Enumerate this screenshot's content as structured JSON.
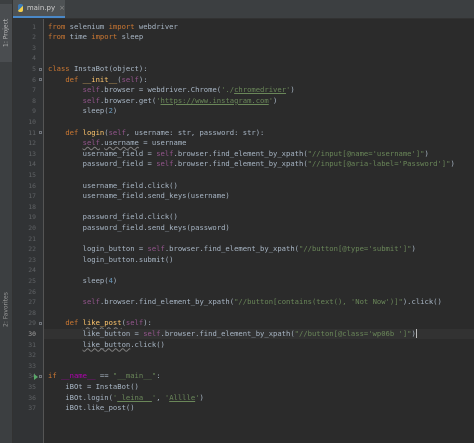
{
  "sidebar": {
    "project_tab_label": "1: Project",
    "favorites_label": "2: Favorites"
  },
  "tab": {
    "label": "main.py",
    "close_glyph": "×"
  },
  "editor": {
    "current_line": 30,
    "line_numbers": [
      "1",
      "2",
      "3",
      "4",
      "5",
      "6",
      "7",
      "8",
      "9",
      "10",
      "11",
      "12",
      "13",
      "14",
      "15",
      "16",
      "17",
      "18",
      "19",
      "20",
      "21",
      "22",
      "23",
      "24",
      "25",
      "26",
      "27",
      "28",
      "29",
      "30",
      "31",
      "32",
      "33",
      "34",
      "35",
      "36",
      "37"
    ],
    "lines": [
      [
        [
          "kw",
          "from"
        ],
        [
          "t",
          " selenium "
        ],
        [
          "kw",
          "import"
        ],
        [
          "t",
          " webdriver"
        ]
      ],
      [
        [
          "kw",
          "from"
        ],
        [
          "t",
          " time "
        ],
        [
          "kw",
          "import"
        ],
        [
          "t",
          " sleep"
        ]
      ],
      [],
      [],
      [
        [
          "kw",
          "class"
        ],
        [
          "t",
          " InstaBot(object):"
        ]
      ],
      [
        [
          "t",
          "    "
        ],
        [
          "kw",
          "def"
        ],
        [
          "t",
          " "
        ],
        [
          "fn",
          "__init__"
        ],
        [
          "t",
          "("
        ],
        [
          "self",
          "self"
        ],
        [
          "t",
          "):"
        ]
      ],
      [
        [
          "t",
          "        "
        ],
        [
          "self",
          "self"
        ],
        [
          "t",
          ".browser = webdriver.Chrome("
        ],
        [
          "str",
          "'./"
        ],
        [
          "strul",
          "chromedriver"
        ],
        [
          "str",
          "'"
        ],
        [
          "t",
          ")"
        ]
      ],
      [
        [
          "t",
          "        "
        ],
        [
          "self",
          "self"
        ],
        [
          "t",
          ".browser.get("
        ],
        [
          "str",
          "'"
        ],
        [
          "strul",
          "https://www.instagram.com"
        ],
        [
          "str",
          "'"
        ],
        [
          "t",
          ")"
        ]
      ],
      [
        [
          "t",
          "        sleep("
        ],
        [
          "num",
          "2"
        ],
        [
          "t",
          ")"
        ]
      ],
      [],
      [
        [
          "t",
          "    "
        ],
        [
          "kw",
          "def"
        ],
        [
          "t",
          " "
        ],
        [
          "fn",
          "login"
        ],
        [
          "t",
          "("
        ],
        [
          "self",
          "self"
        ],
        [
          "t",
          ", username: str, password: str):"
        ]
      ],
      [
        [
          "t",
          "        "
        ],
        [
          "selfw",
          "self"
        ],
        [
          "t",
          "."
        ],
        [
          "tw",
          "username"
        ],
        [
          "t",
          " = username"
        ]
      ],
      [
        [
          "t",
          "        username_field = "
        ],
        [
          "self",
          "self"
        ],
        [
          "t",
          ".browser.find_element_by_xpath("
        ],
        [
          "str",
          "\"//input[@name='username']\""
        ],
        [
          "t",
          ")"
        ]
      ],
      [
        [
          "t",
          "        password_field = "
        ],
        [
          "self",
          "self"
        ],
        [
          "t",
          ".browser.find_element_by_xpath("
        ],
        [
          "str",
          "\"//input[@aria-label='Password']\""
        ],
        [
          "t",
          ")"
        ]
      ],
      [],
      [
        [
          "t",
          "        username_field.click()"
        ]
      ],
      [
        [
          "t",
          "        username_field.send_keys(username)"
        ]
      ],
      [],
      [
        [
          "t",
          "        password_field.click()"
        ]
      ],
      [
        [
          "t",
          "        password_field.send_keys(password)"
        ]
      ],
      [],
      [
        [
          "t",
          "        login_button = "
        ],
        [
          "self",
          "self"
        ],
        [
          "t",
          ".browser.find_element_by_xpath("
        ],
        [
          "str",
          "\"//button[@type='submit']\""
        ],
        [
          "t",
          ")"
        ]
      ],
      [
        [
          "t",
          "        login_button.submit()"
        ]
      ],
      [],
      [
        [
          "t",
          "        sleep("
        ],
        [
          "num",
          "4"
        ],
        [
          "t",
          ")"
        ]
      ],
      [],
      [
        [
          "t",
          "        "
        ],
        [
          "self",
          "self"
        ],
        [
          "t",
          ".browser.find_element_by_xpath("
        ],
        [
          "str",
          "\"//button[contains(text(), 'Not Now')]\""
        ],
        [
          "t",
          ").click()"
        ]
      ],
      [],
      [
        [
          "t",
          "    "
        ],
        [
          "kw",
          "def"
        ],
        [
          "t",
          " "
        ],
        [
          "fnw",
          "like_post"
        ],
        [
          "t",
          "("
        ],
        [
          "self",
          "self"
        ],
        [
          "t",
          "):"
        ]
      ],
      [
        [
          "t",
          "        like_button = "
        ],
        [
          "self",
          "self"
        ],
        [
          "t",
          ".browser.find_element_by_xpath("
        ],
        [
          "str",
          "\"//button[@class='wp06b ']\""
        ],
        [
          "t",
          ")"
        ],
        [
          "cursor",
          ""
        ]
      ],
      [
        [
          "t",
          "        "
        ],
        [
          "tw",
          "like_button"
        ],
        [
          "t",
          ".click()"
        ]
      ],
      [],
      [],
      [
        [
          "kw",
          "if"
        ],
        [
          "t",
          " "
        ],
        [
          "dunder",
          "__name__"
        ],
        [
          "t",
          " == "
        ],
        [
          "str",
          "\"__main__\""
        ],
        [
          "t",
          ":"
        ]
      ],
      [
        [
          "t",
          "    iBOt = InstaBot()"
        ]
      ],
      [
        [
          "t",
          "    iBOt.login("
        ],
        [
          "str",
          "'"
        ],
        [
          "strul",
          "_leina__"
        ],
        [
          "str",
          "'"
        ],
        [
          "t",
          ", "
        ],
        [
          "str",
          "'"
        ],
        [
          "strul",
          "Alllle"
        ],
        [
          "str",
          "'"
        ],
        [
          "t",
          ")"
        ]
      ],
      [
        [
          "t",
          "    iBOt.like_post()"
        ]
      ]
    ]
  },
  "colors": {
    "background": "#2b2b2b",
    "gutter": "#313335",
    "keyword": "#cc7832",
    "string": "#6a8759",
    "number": "#6897bb",
    "self": "#94558d",
    "function": "#ffc66d",
    "text": "#a9b7c6",
    "run_marker": "#59a869"
  },
  "icons": {
    "file_icon": "python-file-icon",
    "run_marker": "run-arrow-icon",
    "fold": "fold-marker-icon"
  }
}
